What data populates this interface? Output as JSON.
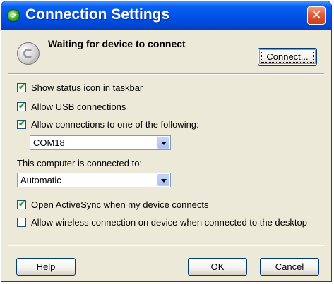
{
  "window": {
    "title": "Connection Settings"
  },
  "status": {
    "text": "Waiting for device to connect",
    "connect_label": "Connect..."
  },
  "options": {
    "show_status_icon": {
      "label": "Show status icon in taskbar",
      "checked": true
    },
    "allow_usb": {
      "label": "Allow USB connections",
      "checked": true
    },
    "allow_port": {
      "label": "Allow connections to one of the following:",
      "checked": true,
      "port_value": "COM18"
    },
    "connected_to": {
      "label": "This computer is connected to:",
      "value": "Automatic"
    },
    "open_activesync": {
      "label": "Open ActiveSync when my device connects",
      "checked": true
    },
    "allow_wireless": {
      "label": "Allow wireless connection on device when connected to the desktop",
      "checked": false
    }
  },
  "footer": {
    "help_label": "Help",
    "ok_label": "OK",
    "cancel_label": "Cancel"
  },
  "icons": {
    "title": "activesync-icon",
    "close": "close-icon",
    "device": "sync-status-icon",
    "check": "checkmark-icon",
    "dropdown": "chevron-down-icon"
  }
}
